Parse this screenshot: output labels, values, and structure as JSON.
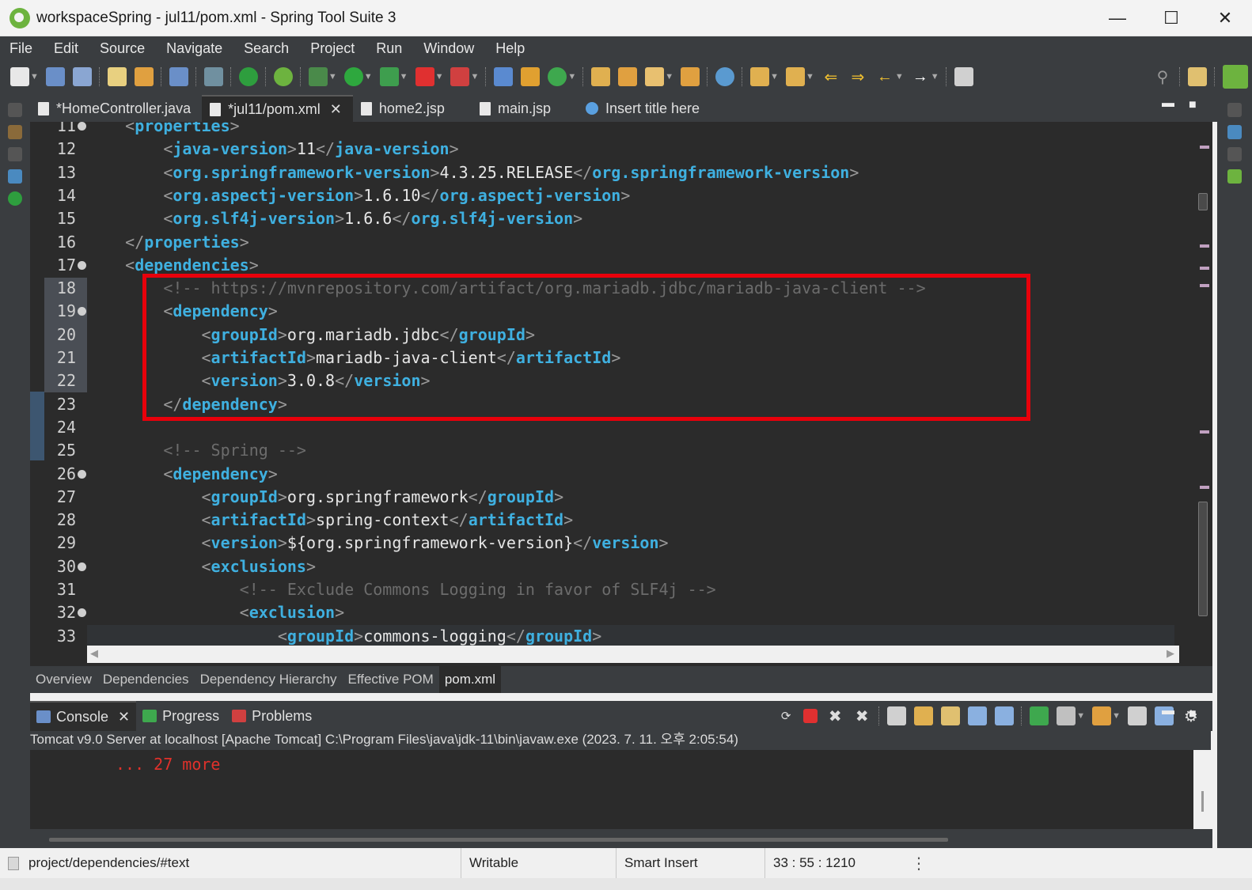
{
  "window": {
    "title": "workspaceSpring - jul11/pom.xml - Spring Tool Suite 3",
    "minimize": "—",
    "maximize": "☐",
    "close": "✕"
  },
  "menu": [
    "File",
    "Edit",
    "Source",
    "Navigate",
    "Search",
    "Project",
    "Run",
    "Window",
    "Help"
  ],
  "editor_tabs": [
    {
      "label": "*HomeController.java",
      "active": false
    },
    {
      "label": "*jul11/pom.xml",
      "active": true
    },
    {
      "label": "home2.jsp",
      "active": false
    },
    {
      "label": "main.jsp",
      "active": false
    },
    {
      "label": "Insert title here",
      "active": false
    }
  ],
  "code_lines": [
    {
      "num": "11",
      "fold": true,
      "text": "    <properties>"
    },
    {
      "num": "12",
      "fold": false,
      "text": "        <java-version>11</java-version>"
    },
    {
      "num": "13",
      "fold": false,
      "text": "        <org.springframework-version>4.3.25.RELEASE</org.springframework-version>"
    },
    {
      "num": "14",
      "fold": false,
      "text": "        <org.aspectj-version>1.6.10</org.aspectj-version>"
    },
    {
      "num": "15",
      "fold": false,
      "text": "        <org.slf4j-version>1.6.6</org.slf4j-version>"
    },
    {
      "num": "16",
      "fold": false,
      "text": "    </properties>"
    },
    {
      "num": "17",
      "fold": true,
      "text": "    <dependencies>"
    },
    {
      "num": "18",
      "fold": false,
      "text": "        <!-- https://mvnrepository.com/artifact/org.mariadb.jdbc/mariadb-java-client -->"
    },
    {
      "num": "19",
      "fold": true,
      "text": "        <dependency>"
    },
    {
      "num": "20",
      "fold": false,
      "text": "            <groupId>org.mariadb.jdbc</groupId>"
    },
    {
      "num": "21",
      "fold": false,
      "text": "            <artifactId>mariadb-java-client</artifactId>"
    },
    {
      "num": "22",
      "fold": false,
      "text": "            <version>3.0.8</version>"
    },
    {
      "num": "23",
      "fold": false,
      "text": "        </dependency>"
    },
    {
      "num": "24",
      "fold": false,
      "text": ""
    },
    {
      "num": "25",
      "fold": false,
      "text": "        <!-- Spring -->"
    },
    {
      "num": "26",
      "fold": true,
      "text": "        <dependency>"
    },
    {
      "num": "27",
      "fold": false,
      "text": "            <groupId>org.springframework</groupId>"
    },
    {
      "num": "28",
      "fold": false,
      "text": "            <artifactId>spring-context</artifactId>"
    },
    {
      "num": "29",
      "fold": false,
      "text": "            <version>${org.springframework-version}</version>"
    },
    {
      "num": "30",
      "fold": true,
      "text": "            <exclusions>"
    },
    {
      "num": "31",
      "fold": false,
      "text": "                <!-- Exclude Commons Logging in favor of SLF4j -->"
    },
    {
      "num": "32",
      "fold": true,
      "text": "                <exclusion>"
    },
    {
      "num": "33",
      "fold": false,
      "text": "                    <groupId>commons-logging</groupId>"
    }
  ],
  "pom_tabs": [
    {
      "label": "Overview",
      "active": false
    },
    {
      "label": "Dependencies",
      "active": false
    },
    {
      "label": "Dependency Hierarchy",
      "active": false
    },
    {
      "label": "Effective POM",
      "active": false
    },
    {
      "label": "pom.xml",
      "active": true
    }
  ],
  "console_tabs": [
    {
      "label": "Console",
      "active": true
    },
    {
      "label": "Progress",
      "active": false
    },
    {
      "label": "Problems",
      "active": false
    }
  ],
  "console": {
    "header": "Tomcat v9.0 Server at localhost [Apache Tomcat] C:\\Program Files\\java\\jdk-11\\bin\\javaw.exe  (2023. 7. 11. 오후 2:05:54)",
    "output": "... 27 more"
  },
  "status": {
    "path": "project/dependencies/#text",
    "writable": "Writable",
    "insert_mode": "Smart Insert",
    "position": "33 : 55 : 1210"
  },
  "colors": {
    "tag": "#3fb0e0",
    "bracket": "#9a9a9a",
    "comment": "#6c6c6c",
    "highlight_box": "#e8000b",
    "console_error": "#e0312b"
  }
}
